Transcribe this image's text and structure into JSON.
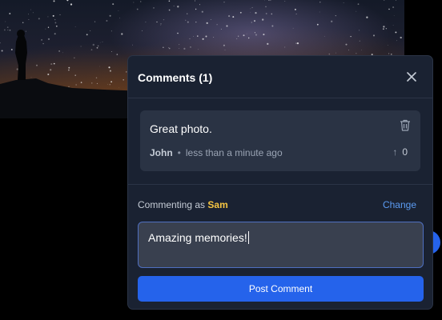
{
  "panel": {
    "title": "Comments (1)",
    "close_icon": "close-icon"
  },
  "comments": [
    {
      "text": "Great photo.",
      "author": "John",
      "separator": "•",
      "time": "less than a minute ago",
      "votes": "0",
      "vote_icon": "arrow-up-icon",
      "delete_icon": "trash-icon"
    }
  ],
  "composer": {
    "commenting_as_label": "Commenting as",
    "user": "Sam",
    "change_label": "Change",
    "input_value": "Amazing memories!",
    "post_label": "Post Comment"
  },
  "colors": {
    "accent": "#2563eb",
    "username": "#f5c542",
    "panel_bg": "#1a2232"
  }
}
